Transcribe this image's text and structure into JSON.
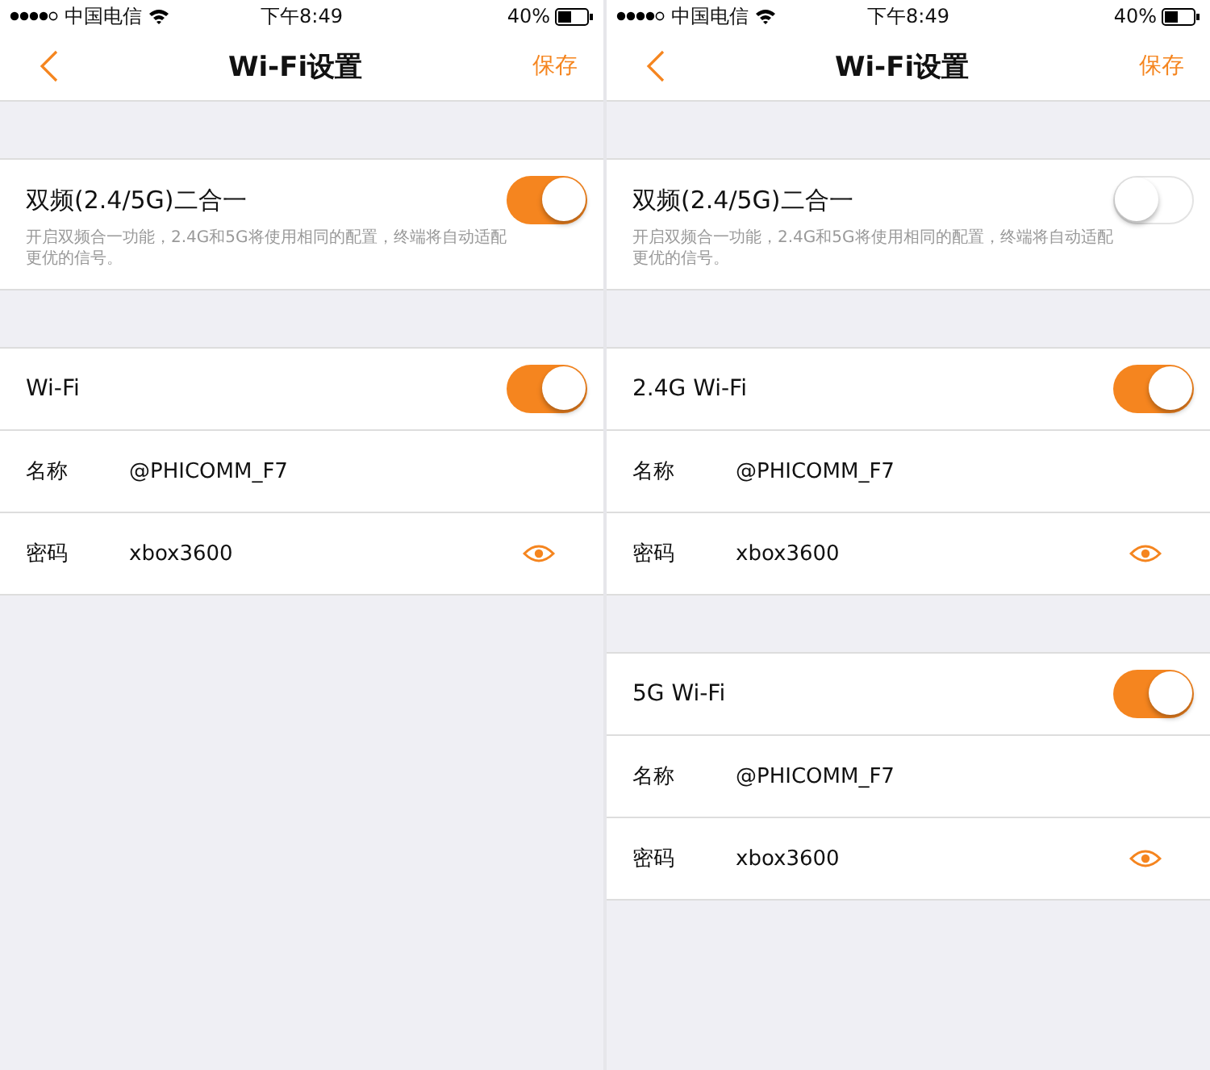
{
  "screens": [
    {
      "status_bar": {
        "carrier": "中国电信",
        "time": "下午8:49",
        "battery": "40%"
      },
      "nav": {
        "title": "Wi-Fi设置",
        "action": "保存"
      },
      "dual_band": {
        "label": "双频(2.4/5G)二合一",
        "description": "开启双频合一功能，2.4G和5G将使用相同的配置，终端将自动适配更优的信号。",
        "on": true
      },
      "groups": [
        {
          "label": "Wi-Fi",
          "on": true,
          "fields": [
            {
              "kind": "text",
              "label": "名称",
              "value": "@PHICOMM_F7"
            },
            {
              "kind": "password",
              "label": "密码",
              "value": "xbox3600"
            }
          ]
        }
      ]
    },
    {
      "status_bar": {
        "carrier": "中国电信",
        "time": "下午8:49",
        "battery": "40%"
      },
      "nav": {
        "title": "Wi-Fi设置",
        "action": "保存"
      },
      "dual_band": {
        "label": "双频(2.4/5G)二合一",
        "description": "开启双频合一功能，2.4G和5G将使用相同的配置，终端将自动适配更优的信号。",
        "on": false
      },
      "groups": [
        {
          "label": "2.4G Wi-Fi",
          "on": true,
          "fields": [
            {
              "kind": "text",
              "label": "名称",
              "value": "@PHICOMM_F7"
            },
            {
              "kind": "password",
              "label": "密码",
              "value": "xbox3600"
            }
          ]
        },
        {
          "label": "5G Wi-Fi",
          "on": true,
          "fields": [
            {
              "kind": "text",
              "label": "名称",
              "value": "@PHICOMM_F7"
            },
            {
              "kind": "password",
              "label": "密码",
              "value": "xbox3600"
            }
          ]
        }
      ]
    }
  ]
}
